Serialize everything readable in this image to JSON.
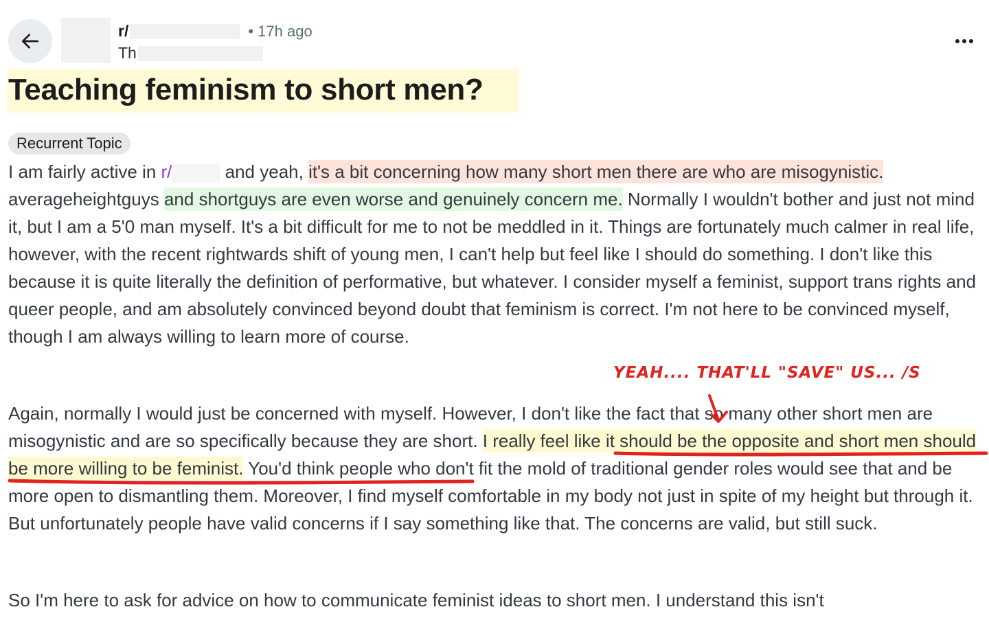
{
  "header": {
    "subreddit_prefix": "r/",
    "age": "• 17h ago",
    "user_prefix": "Th",
    "back_icon": "arrow-left-icon",
    "more_icon": "more-horizontal-icon"
  },
  "post": {
    "title": "Teaching feminism to short men?",
    "flair": "Recurrent Topic",
    "p1": {
      "t1": "I am fairly active in ",
      "link": "r/",
      "t2": " and yeah, ",
      "h1": "it's a bit concerning how many short men there are who are misogynistic.",
      "t3": " averageheightguys ",
      "h2": "and shortguys are even worse and genuinely concern me.",
      "t4": " Normally I wouldn't bother and just not mind it, but I am a 5'0 man myself. It's a bit difficult for me to not be meddled in it. Things are fortunately much calmer in real life, however, with the recent rightwards shift of young men, I can't help but feel like I should do something. I don't like this because it is quite literally the definition of performative, but whatever. I consider myself a feminist, support trans rights and queer people, and am absolutely convinced beyond doubt that feminism is correct. I'm not here to be convinced myself, though I am always willing to learn more of course."
    },
    "p2": {
      "t1": "Again, normally I would just be concerned with myself. However, I don't like the fact that so many other short men are misogynistic and are so specifically because they are short. ",
      "h1": "I really feel like it should be the opposite and short men should be more willing to be feminist.",
      "t2": " You'd think people who don't fit the mold of traditional gender roles would see that and be more open to dismantling them. Moreover, I find myself comfortable in my body not just in spite of my height but through it. But unfortunately people have valid concerns if I say something like that. The concerns are valid, but still suck."
    },
    "p3": "So I'm here to ask for advice on how to communicate feminist ideas to short men. I understand this isn't"
  },
  "annotation": {
    "text": "YEAH.... THAT'LL \"SAVE\" US...  /S",
    "color": "#e0231c"
  },
  "colors": {
    "highlight_pink": "#fde3da",
    "highlight_green": "#e2f8e2",
    "highlight_yellow": "#fdf9d0",
    "subreddit_link": "#8f3bd0",
    "annotation_red": "#e0231c"
  }
}
